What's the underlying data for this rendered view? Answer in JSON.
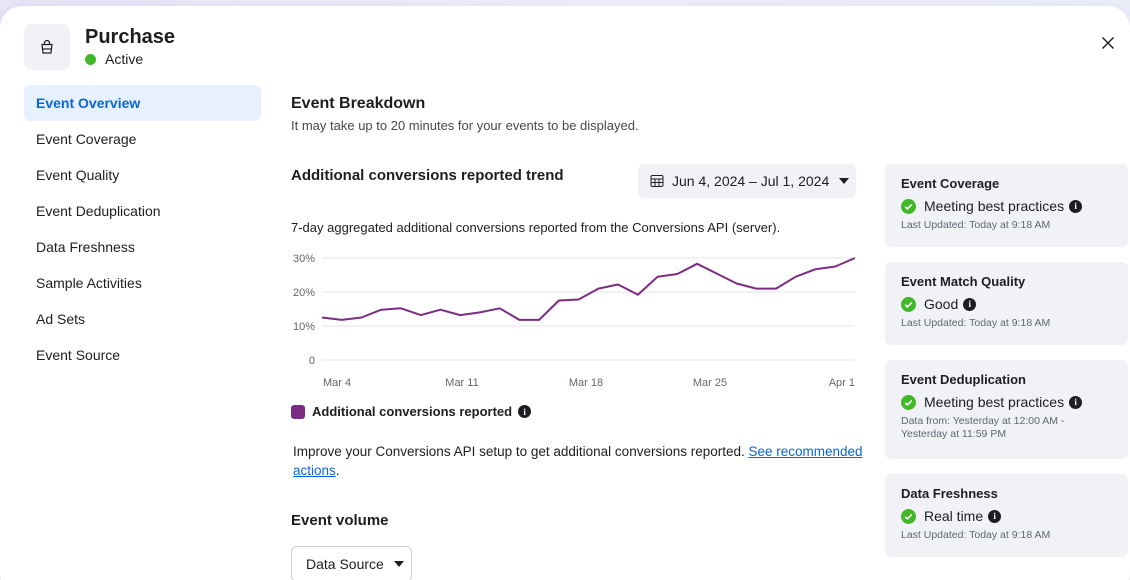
{
  "header": {
    "title": "Purchase",
    "status": "Active",
    "icon": "shopping-bag-icon",
    "status_color": "#42b72a"
  },
  "sidebar": {
    "items": [
      {
        "label": "Event Overview",
        "active": true
      },
      {
        "label": "Event Coverage"
      },
      {
        "label": "Event Quality"
      },
      {
        "label": "Event Deduplication"
      },
      {
        "label": "Data Freshness"
      },
      {
        "label": "Sample Activities"
      },
      {
        "label": "Ad Sets"
      },
      {
        "label": "Event Source"
      }
    ]
  },
  "main": {
    "title": "Event Breakdown",
    "subtitle": "It may take up to 20 minutes for your events to be displayed.",
    "trend_title": "Additional conversions reported trend",
    "date_range": "Jun 4, 2024 – Jul 1, 2024",
    "chart_description": "7-day aggregated additional conversions reported from the Conversions API (server).",
    "legend_label": "Additional conversions reported",
    "improve_text": "Improve your Conversions API setup to get additional conversions reported. ",
    "improve_link": "See recommended actions",
    "event_volume_title": "Event volume",
    "data_source_label": "Data Source"
  },
  "chart_data": {
    "type": "line",
    "x_ticks": [
      "Mar 4",
      "Mar 11",
      "Mar 18",
      "Mar 25",
      "Apr 1"
    ],
    "y_ticks": [
      "0",
      "10%",
      "20%",
      "30%"
    ],
    "ylim": [
      0,
      30
    ],
    "grid": true,
    "series": [
      {
        "name": "Additional conversions reported",
        "color": "#7b2d84",
        "values": [
          12.5,
          11.8,
          12.5,
          14.8,
          15.2,
          13.2,
          14.8,
          13.2,
          14,
          15.2,
          11.8,
          11.8,
          17.5,
          17.8,
          21,
          22.2,
          19.2,
          24.5,
          25.3,
          28.3,
          25.4,
          22.5,
          21,
          21,
          24.5,
          26.7,
          27.5,
          30
        ]
      }
    ]
  },
  "cards": [
    {
      "title": "Event Coverage",
      "status": "Meeting best practices",
      "updated": "Last Updated: Today at 9:18 AM"
    },
    {
      "title": "Event Match Quality",
      "status": "Good",
      "updated": "Last Updated: Today at 9:18 AM"
    },
    {
      "title": "Event Deduplication",
      "status": "Meeting best practices",
      "updated": "Data from: Yesterday at 12:00 AM - Yesterday at 11:59 PM"
    },
    {
      "title": "Data Freshness",
      "status": "Real time",
      "updated": "Last Updated: Today at 9:18 AM"
    }
  ],
  "colors": {
    "accent": "#0a66d6",
    "success": "#42b72a",
    "series": "#7b2d84"
  }
}
